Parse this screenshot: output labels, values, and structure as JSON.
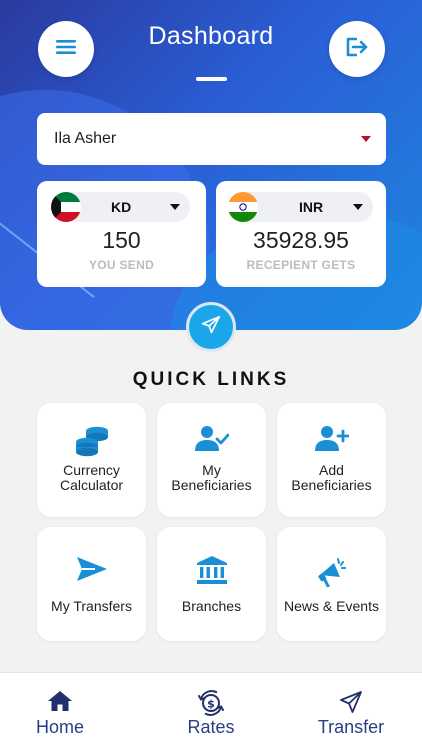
{
  "header": {
    "title": "Dashboard",
    "menu_icon": "menu-icon",
    "logout_icon": "logout-icon"
  },
  "beneficiary_select": {
    "value": "Ila Asher"
  },
  "send_card": {
    "currency": "KD",
    "flag": "kuwait-flag",
    "amount": "150",
    "label": "YOU SEND"
  },
  "receive_card": {
    "currency": "INR",
    "flag": "india-flag",
    "amount": "35928.95",
    "label": "RECEPIENT GETS"
  },
  "quick_links": {
    "title": "QUICK LINKS",
    "items": [
      {
        "label": "Currency\nCalculator",
        "icon": "coins-icon"
      },
      {
        "label": "My\nBeneficiaries",
        "icon": "user-check-icon"
      },
      {
        "label": "Add\nBeneficiaries",
        "icon": "user-plus-icon"
      },
      {
        "label": "My Transfers",
        "icon": "paper-plane-icon"
      },
      {
        "label": "Branches",
        "icon": "bank-icon"
      },
      {
        "label": "News & Events",
        "icon": "megaphone-icon"
      }
    ]
  },
  "bottom_nav": {
    "items": [
      {
        "label": "Home",
        "icon": "home-icon"
      },
      {
        "label": "Rates",
        "icon": "rates-icon"
      },
      {
        "label": "Transfer",
        "icon": "send-icon"
      }
    ]
  },
  "colors": {
    "accent": "#1a8fd6",
    "nav_text": "#2a3e86",
    "hero_gradient_start": "#2b3a9f",
    "hero_gradient_end": "#1f86df",
    "send_button": "#1aa6e8"
  }
}
